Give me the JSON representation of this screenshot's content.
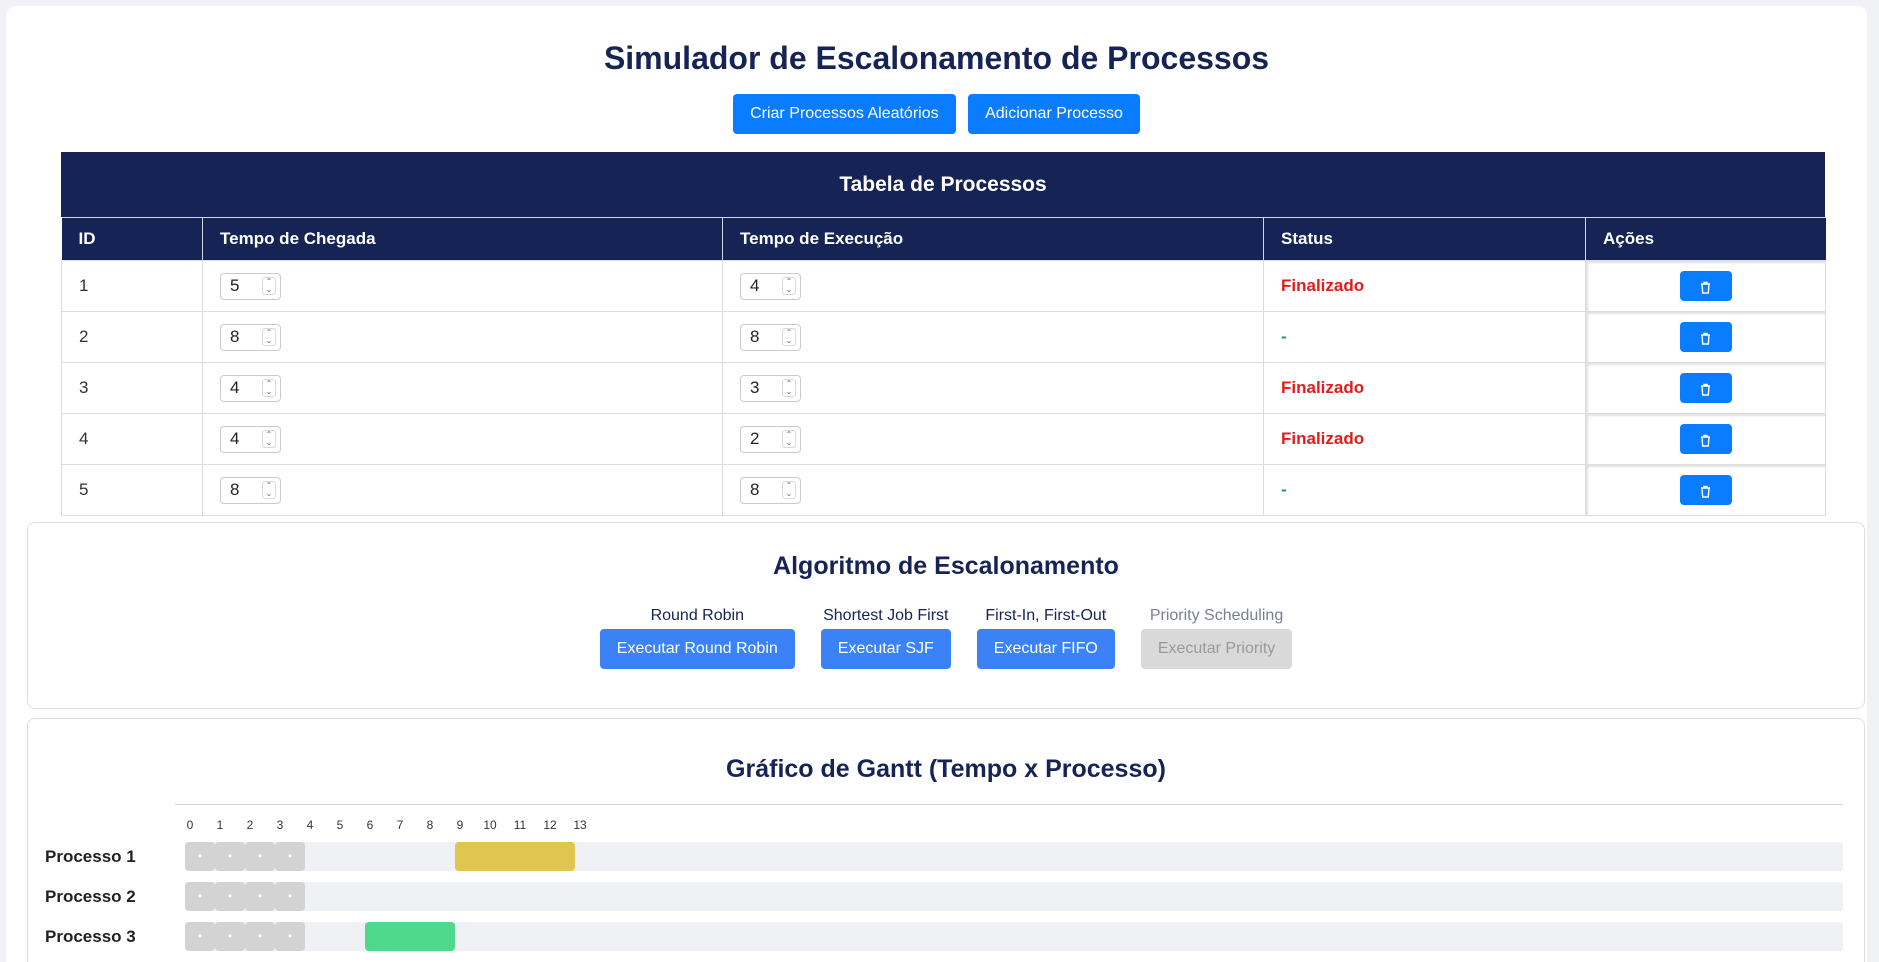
{
  "title": "Simulador de Escalonamento de Processos",
  "top_buttons": {
    "random": "Criar Processos Aleatórios",
    "add": "Adicionar Processo"
  },
  "table": {
    "title": "Tabela de Processos",
    "headers": [
      "ID",
      "Tempo de Chegada",
      "Tempo de Execução",
      "Status",
      "Ações"
    ],
    "rows": [
      {
        "id": "1",
        "arrival": "5",
        "exec": "4",
        "status": "Finalizado"
      },
      {
        "id": "2",
        "arrival": "8",
        "exec": "8",
        "status": "-"
      },
      {
        "id": "3",
        "arrival": "4",
        "exec": "3",
        "status": "Finalizado"
      },
      {
        "id": "4",
        "arrival": "4",
        "exec": "2",
        "status": "Finalizado"
      },
      {
        "id": "5",
        "arrival": "8",
        "exec": "8",
        "status": "-"
      }
    ],
    "delete_icon": "trash-icon"
  },
  "algorithms": {
    "title": "Algoritmo de Escalonamento",
    "items": [
      {
        "label": "Round Robin",
        "button": "Executar Round Robin",
        "enabled": true
      },
      {
        "label": "Shortest Job First",
        "button": "Executar SJF",
        "enabled": true
      },
      {
        "label": "First-In, First-Out",
        "button": "Executar FIFO",
        "enabled": true
      },
      {
        "label": "Priority Scheduling",
        "button": "Executar Priority",
        "enabled": false
      }
    ]
  },
  "gantt": {
    "title": "Gráfico de Gantt (Tempo x Processo)",
    "ticks": [
      "0",
      "1",
      "2",
      "3",
      "4",
      "5",
      "6",
      "7",
      "8",
      "9",
      "10",
      "11",
      "12",
      "13"
    ],
    "wait_marker": "•",
    "rows": [
      {
        "label": "Processo 1",
        "wait": [
          0,
          1,
          2,
          3
        ],
        "run": {
          "start": 9,
          "end": 13,
          "color": "#e0c64f"
        }
      },
      {
        "label": "Processo 2",
        "wait": [
          0,
          1,
          2,
          3
        ],
        "run": null
      },
      {
        "label": "Processo 3",
        "wait": [
          0,
          1,
          2,
          3
        ],
        "run": {
          "start": 6,
          "end": 9,
          "color": "#4fd98c"
        }
      }
    ]
  },
  "colors": {
    "primary": "#0a7cff",
    "navy": "#162455",
    "finalizado": "#e21c1c",
    "pending": "#18a34a"
  }
}
